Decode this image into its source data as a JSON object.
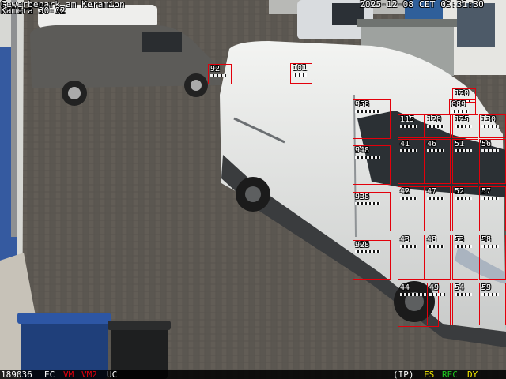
{
  "osd": {
    "site_name": "Gewerbepark am Keramion",
    "camera_name": "Kamera 30-02",
    "datetime": "2025-12-08 CET 09:31:30"
  },
  "status_bar": {
    "frame_counter": "189036",
    "flag_ec": "EC",
    "flag_vm": "VM",
    "flag_vm2": "VM2",
    "flag_uc": "UC",
    "flag_ip": "(IP)",
    "flag_fs": "FS",
    "flag_rec": "REC",
    "flag_dy": "DY"
  },
  "colors": {
    "osd_text": "#ffffff",
    "detection_box": "#e3000b",
    "flag_vm": "#e3000b",
    "flag_fs": "#f2e600",
    "flag_rec": "#1ec81e",
    "flag_dy": "#f2e600"
  },
  "detections": [
    "92",
    "101",
    "120",
    "089",
    "958",
    "115",
    "120",
    "125",
    "130",
    "948",
    "41",
    "46",
    "51",
    "56",
    "938",
    "42",
    "47",
    "52",
    "57",
    "928",
    "43",
    "48",
    "53",
    "58",
    "44",
    "49",
    "54",
    "59"
  ]
}
